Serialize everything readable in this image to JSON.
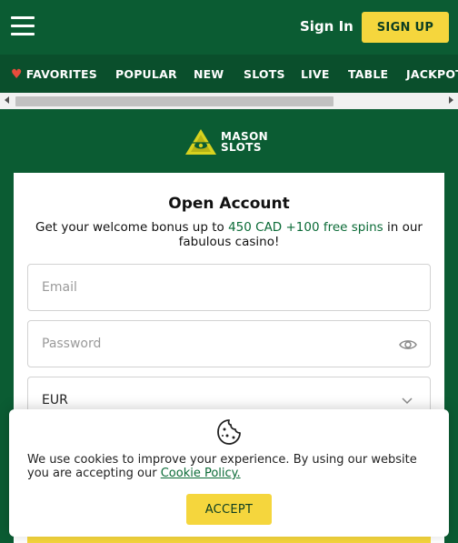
{
  "header": {
    "signin_label": "Sign In",
    "signup_label": "SIGN UP"
  },
  "nav": {
    "items": [
      {
        "label": "FAVORITES",
        "icon": "heart-icon"
      },
      {
        "label": "POPULAR"
      },
      {
        "label": "NEW"
      },
      {
        "label": "SLOTS"
      },
      {
        "label": "LIVE"
      },
      {
        "label": "TABLE"
      },
      {
        "label": "JACKPOTS"
      }
    ]
  },
  "logo": {
    "line1": "MASON",
    "line2": "SLOTS"
  },
  "form": {
    "title": "Open Account",
    "subtitle_pre": "Get your welcome bonus up to ",
    "subtitle_highlight": "450 CAD +100 free spins",
    "subtitle_post": " in our fabulous casino!",
    "email_placeholder": "Email",
    "password_placeholder": "Password",
    "currency_value": "EUR"
  },
  "cookie": {
    "text": "We use cookies to improve your experience. By using our website you are accepting our ",
    "link_label": "Cookie Policy.",
    "accept_label": "ACCEPT"
  },
  "colors": {
    "brand_green": "#0b5c33",
    "nav_green": "#0a4f2c",
    "accent_yellow": "#f5d63d",
    "link_green": "#0b6b37"
  }
}
